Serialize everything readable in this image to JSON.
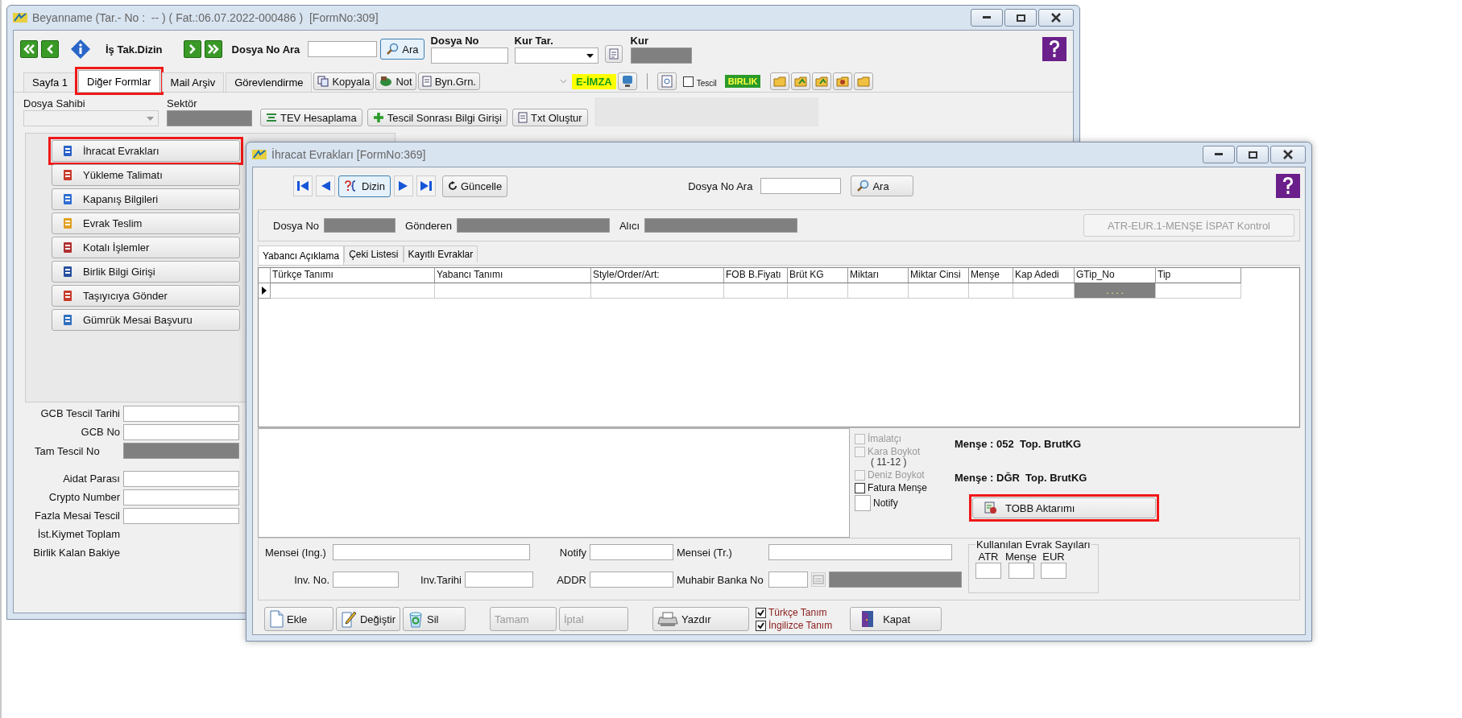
{
  "main_window": {
    "title": "Beyanname (Tar.- No :  -- ) ( Fat.:06.07.2022-000486 )  [FormNo:309]",
    "toolbar": {
      "worklist_label": "İş Tak.Dizin",
      "search_label": "Dosya No Ara",
      "search_button": "Ara",
      "file_no_label": "Dosya No",
      "rate_date_label": "Kur Tar.",
      "rate_label": "Kur"
    },
    "tabs": [
      {
        "label": "Sayfa 1",
        "selected": false,
        "highlighted": false
      },
      {
        "label": "Diğer Formlar",
        "selected": true,
        "highlighted": true
      },
      {
        "label": "Mail Arşiv",
        "selected": false,
        "highlighted": false
      },
      {
        "label": "Görevlendirme",
        "selected": false,
        "highlighted": false
      }
    ],
    "tool_buttons": [
      "Kopyala",
      "Not",
      "Byn.Grn."
    ],
    "e_signature": "E-İMZA",
    "registration_checkbox": {
      "label": "Tescil",
      "checked": false
    },
    "union_badge": "BIRLIK",
    "owner_label": "Dosya Sahibi",
    "sector_label": "Sektör",
    "action_buttons": [
      "TEV Hesaplama",
      "Tescil Sonrası Bilgi Girişi",
      "Txt Oluştur"
    ],
    "form_buttons": [
      {
        "label": "İhracat Evrakları",
        "highlighted": true
      },
      {
        "label": "Yükleme Talimatı",
        "highlighted": false
      },
      {
        "label": "Kapanış Bilgileri",
        "highlighted": false
      },
      {
        "label": "Evrak Teslim",
        "highlighted": false
      },
      {
        "label": "Kotalı İşlemler",
        "highlighted": false
      },
      {
        "label": "Birlik Bilgi Girişi",
        "highlighted": false
      },
      {
        "label": "Taşıyıcıya Gönder",
        "highlighted": false
      },
      {
        "label": "Gümrük Mesai Başvuru",
        "highlighted": false
      }
    ],
    "fields": [
      {
        "label": "GCB Tescil Tarihi",
        "kind": "input"
      },
      {
        "label": "GCB No",
        "kind": "input"
      },
      {
        "label": "Tam Tescil No",
        "kind": "readonly"
      },
      {
        "label": "Aidat Parası",
        "kind": "input"
      },
      {
        "label": "Crypto Number",
        "kind": "input"
      },
      {
        "label": "Fazla Mesai Tescil",
        "kind": "input"
      },
      {
        "label": "İst.Kiymet Toplam",
        "kind": "text"
      },
      {
        "label": "Birlik Kalan Bakiye",
        "kind": "text"
      }
    ]
  },
  "export_window": {
    "title": "İhracat Evrakları [FormNo:369]",
    "index_button": "Dizin",
    "refresh_button": "Güncelle",
    "search_label": "Dosya No Ara",
    "search_button": "Ara",
    "header_fields": [
      "Dosya No",
      "Gönderen",
      "Alıcı"
    ],
    "check_button": {
      "label": "ATR-EUR.1-MENŞE İSPAT Kontrol",
      "disabled": true
    },
    "tabs": [
      {
        "label": "Yabancı Açıklama",
        "selected": true
      },
      {
        "label": "Çeki Listesi",
        "selected": false
      },
      {
        "label": "Kayıtlı Evraklar",
        "selected": false
      }
    ],
    "table": {
      "columns": [
        "Türkçe Tanımı",
        "Yabancı Tanımı",
        "Style/Order/Art:",
        "FOB B.Fiyatı",
        "Brüt KG",
        "Miktarı",
        "Miktar Cinsi",
        "Menşe",
        "Kap Adedi",
        "GTip_No",
        "Tip"
      ],
      "rows": [
        {
          "current": true,
          "gtip_mask": ". . . ."
        }
      ]
    },
    "options": [
      {
        "label": "İmalatçı",
        "checked": false,
        "disabled": true,
        "kind": "small"
      },
      {
        "label": "Kara Boykot",
        "note": "( 11-12 )",
        "checked": false,
        "disabled": true,
        "kind": "small"
      },
      {
        "label": "Deniz Boykot",
        "checked": false,
        "disabled": true,
        "kind": "small"
      },
      {
        "label": "Fatura Menşe",
        "checked": false,
        "disabled": false,
        "kind": "small"
      },
      {
        "label": "Notify",
        "checked": false,
        "disabled": false,
        "kind": "large"
      }
    ],
    "totals": [
      "Menşe : 052  Top. BrutKG",
      "Menşe : DĞR  Top. BrutKG"
    ],
    "tobb_button": {
      "label": "TOBB Aktarımı",
      "highlighted": true
    },
    "field_rows": [
      [
        {
          "label": "Mensei (Ing.)",
          "kind": "input"
        },
        {
          "label": "Notify",
          "kind": "input"
        },
        {
          "label": "Mensei (Tr.)",
          "kind": "input"
        }
      ],
      [
        {
          "label": "Inv. No.",
          "kind": "input"
        },
        {
          "label": "Inv.Tarihi",
          "kind": "input"
        },
        {
          "label": "ADDR",
          "kind": "input"
        },
        {
          "label": "Muhabir Banka No",
          "kind": "lookup"
        }
      ]
    ],
    "counts_group": {
      "title": "Kullanılan Evrak Sayıları",
      "columns": [
        "ATR",
        "Menşe",
        "EUR"
      ]
    },
    "buttons": [
      {
        "label": "Ekle",
        "disabled": false
      },
      {
        "label": "Değiştir",
        "disabled": false
      },
      {
        "label": "Sil",
        "disabled": false
      },
      {
        "label": "Tamam",
        "disabled": true
      },
      {
        "label": "İptal",
        "disabled": true
      },
      {
        "label": "Yazdır",
        "disabled": false
      }
    ],
    "display_options": [
      {
        "label": "Türkçe Tanım",
        "checked": true
      },
      {
        "label": "İngilizce Tanım",
        "checked": true
      }
    ],
    "close_button": "Kapat"
  }
}
